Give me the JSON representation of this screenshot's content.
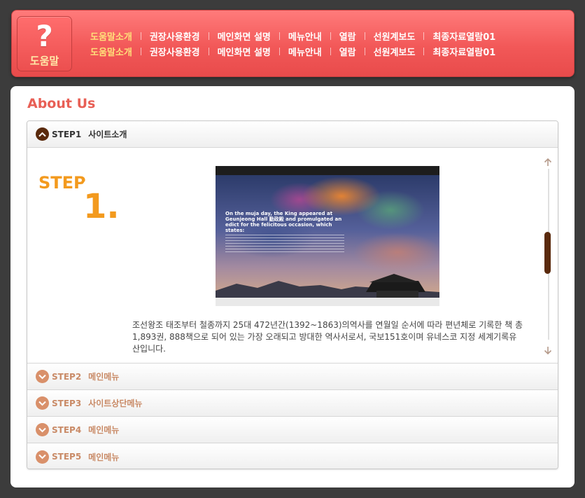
{
  "help": {
    "label": "도움말"
  },
  "nav": {
    "row1": [
      "도움말소개",
      "권장사용환경",
      "메인화면 설명",
      "메뉴안내",
      "열람",
      "선원계보도",
      "최종자료열람01"
    ],
    "row2": [
      "도움말소개",
      "권장사용환경",
      "메인화면 설명",
      "메뉴안내",
      "열람",
      "선원계보도",
      "최종자료열람01"
    ]
  },
  "page": {
    "title": "About Us"
  },
  "steps": [
    {
      "step": "STEP1",
      "title": "사이트소개"
    },
    {
      "step": "STEP2",
      "title": "메인메뉴"
    },
    {
      "step": "STEP3",
      "title": "사이트상단메뉴"
    },
    {
      "step": "STEP4",
      "title": "메인메뉴"
    },
    {
      "step": "STEP5",
      "title": "메인메뉴"
    }
  ],
  "step1": {
    "logo_word": "STEP",
    "logo_num": "1.",
    "description": "조선왕조 태조부터 철종까지 25대 472년간(1392~1863)의역사를 연월일 순서에 따라 편년체로 기록한 책 총 1,893권, 888책으로 되어 있는 가장 오래되고 방대한 역사서로서, 국보151호이며 유네스코 지정 세계기록유산입니다.",
    "image_headline": "On the muja day, the King appeared at Geunjeong Hall 勤政殿 and promulgated an edict for the felicitous occasion, which states:"
  },
  "colors": {
    "header": "#f25858",
    "title": "#e85f55",
    "active_nav": "#ffe07a",
    "open_icon": "#5a2a0d",
    "closed_icon": "#d9906a",
    "step_orange": "#f39a1e"
  },
  "icons": {
    "open": "chevron-up-icon",
    "closed": "chevron-down-icon",
    "scroll_up": "arrow-up-icon",
    "scroll_down": "arrow-down-icon"
  }
}
